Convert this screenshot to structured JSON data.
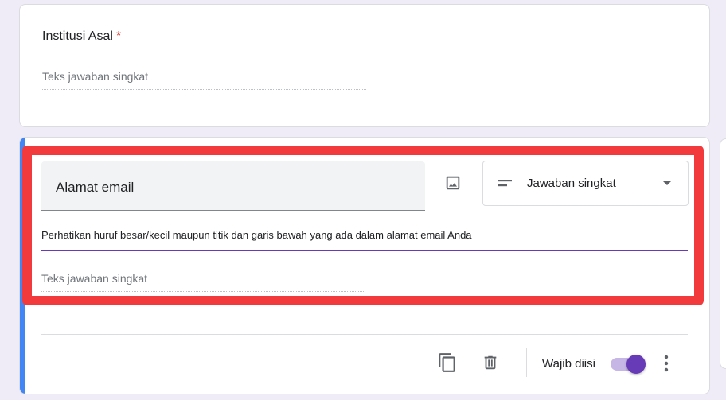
{
  "question1": {
    "title": "Institusi Asal",
    "required_mark": "*",
    "answer_placeholder": "Teks jawaban singkat"
  },
  "question2": {
    "title": "Alamat email",
    "description": "Perhatikan huruf besar/kecil maupun titik dan garis bawah yang ada dalam alamat email Anda",
    "answer_placeholder": "Teks jawaban singkat",
    "type_select": {
      "selected": "Jawaban singkat",
      "icon": "short-text-icon"
    },
    "footer": {
      "required_label": "Wajib diisi",
      "required_on": true
    }
  },
  "colors": {
    "accent": "#673ab7",
    "active_bar": "#4285f4",
    "highlight": "#f23a3c",
    "required_star": "#d93025"
  }
}
